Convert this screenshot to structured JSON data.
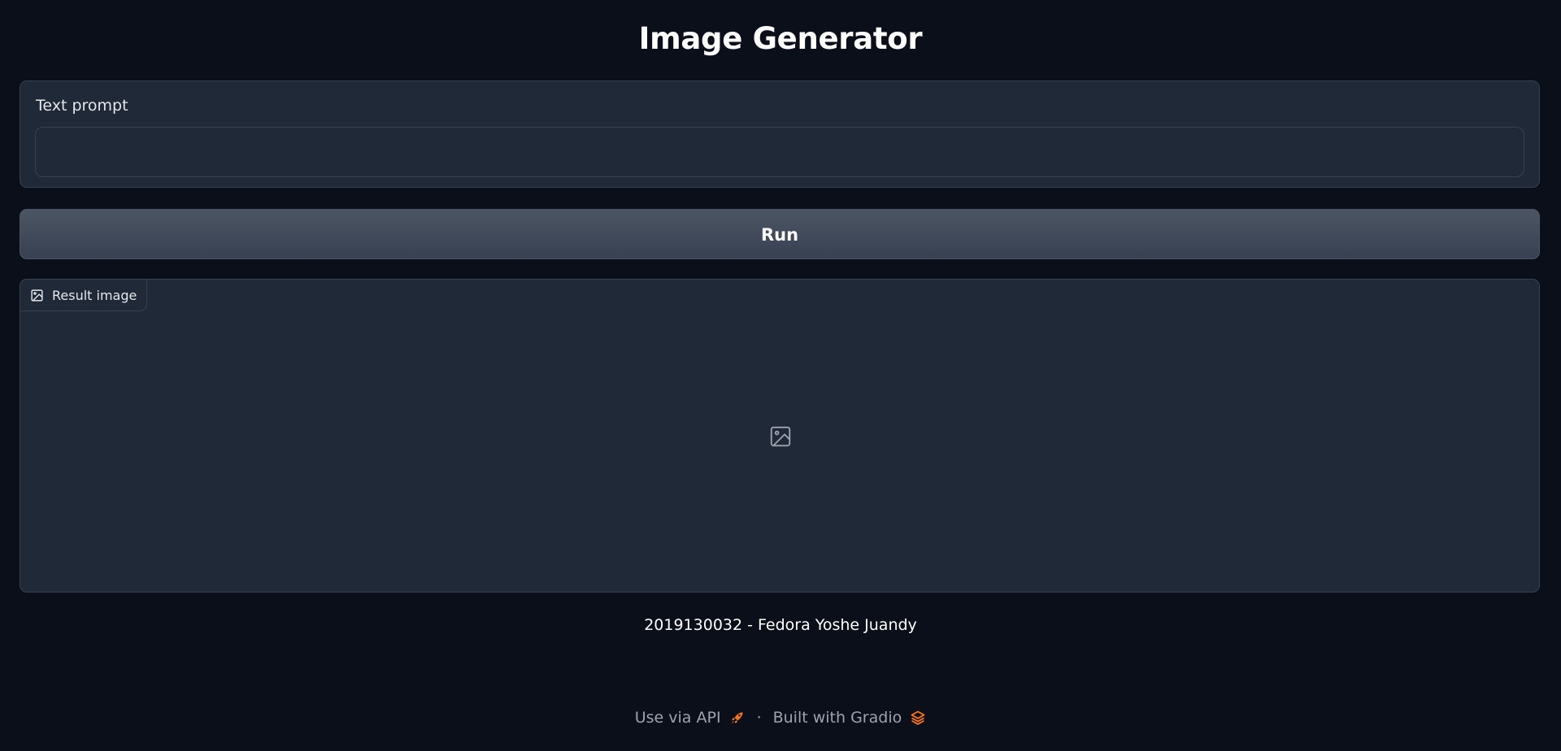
{
  "header": {
    "title": "Image Generator"
  },
  "prompt": {
    "label": "Text prompt",
    "value": "",
    "placeholder": ""
  },
  "run_button": {
    "label": "Run"
  },
  "result": {
    "tab_label": "Result image",
    "tab_icon": "image-icon",
    "placeholder_icon": "image-icon"
  },
  "credit": {
    "text": "2019130032 - Fedora Yoshe Juandy"
  },
  "footer": {
    "api_label": "Use via API",
    "api_icon": "rocket-icon",
    "separator": "·",
    "gradio_label": "Built with Gradio",
    "gradio_icon": "gradio-logo-icon"
  },
  "colors": {
    "background": "#0b0f19",
    "panel": "#1f2937",
    "border": "#374151",
    "button_top": "#4b5563",
    "button_bottom": "#374151",
    "muted_text": "#9ca3af",
    "accent_orange": "#f97316"
  }
}
